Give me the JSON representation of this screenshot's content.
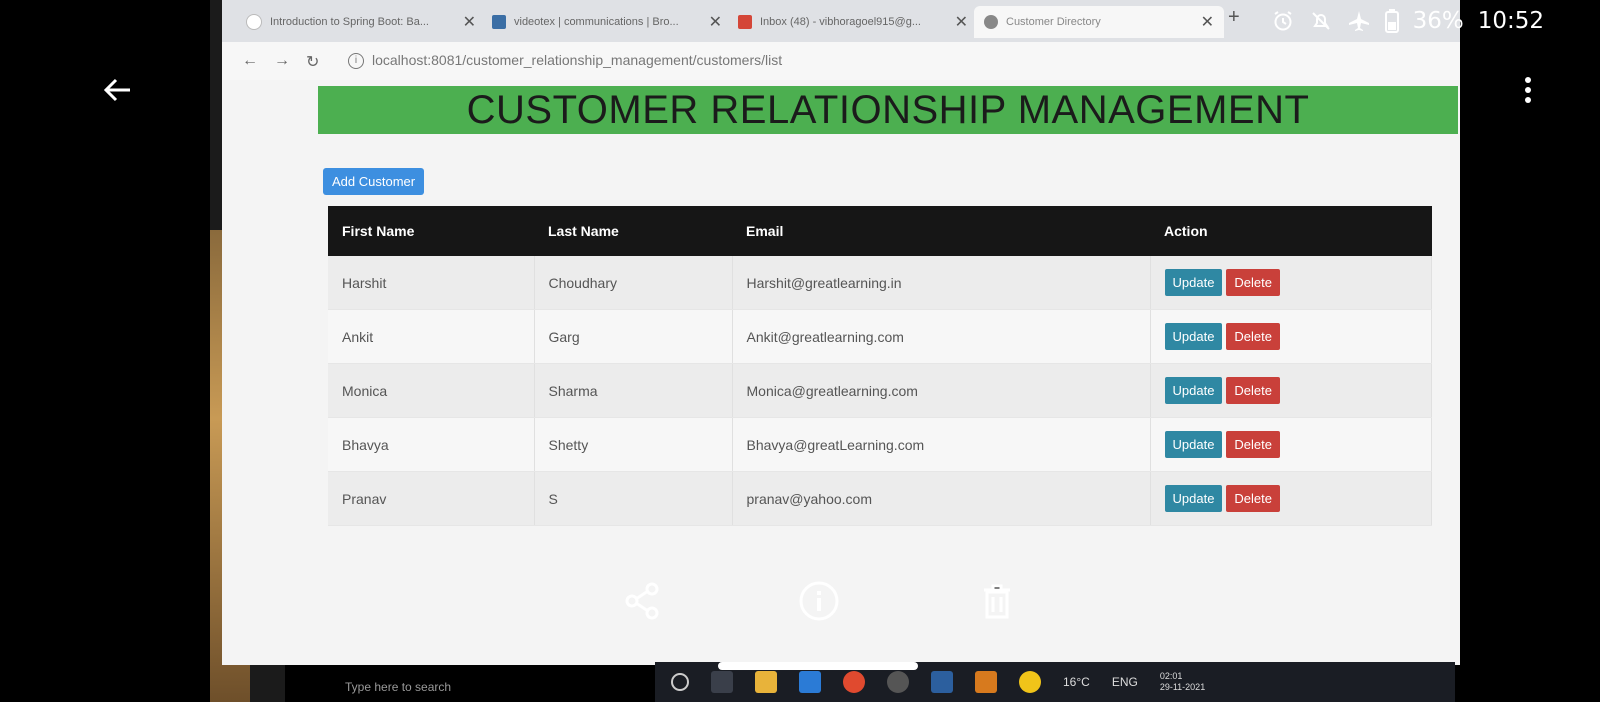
{
  "status": {
    "battery": "36%",
    "time": "10:52"
  },
  "browser": {
    "tabs": [
      {
        "title": "Introduction to Spring Boot: Ba..."
      },
      {
        "title": "videotex | communications | Bro..."
      },
      {
        "title": "Inbox (48) - vibhoragoel915@g..."
      },
      {
        "title": "Customer Directory"
      }
    ],
    "url": "localhost:8081/customer_relationship_management/customers/list"
  },
  "page": {
    "banner_title": "CUSTOMER RELATIONSHIP MANAGEMENT",
    "add_button": "Add Customer",
    "table": {
      "headers": [
        "First Name",
        "Last Name",
        "Email",
        "Action"
      ],
      "rows": [
        {
          "first": "Harshit",
          "last": "Choudhary",
          "email": "Harshit@greatlearning.in"
        },
        {
          "first": "Ankit",
          "last": "Garg",
          "email": "Ankit@greatlearning.com"
        },
        {
          "first": "Monica",
          "last": "Sharma",
          "email": "Monica@greatlearning.com"
        },
        {
          "first": "Bhavya",
          "last": "Shetty",
          "email": "Bhavya@greatLearning.com"
        },
        {
          "first": "Pranav",
          "last": "S",
          "email": "pranav@yahoo.com"
        }
      ],
      "update_label": "Update",
      "delete_label": "Delete"
    }
  },
  "taskbar": {
    "weather": "16°C",
    "lang": "ENG",
    "clock": "02:01",
    "date": "29-11-2021",
    "search_hint": "Type here to search"
  },
  "icons": {
    "back": "back-arrow-icon",
    "menu": "kebab-menu-icon",
    "share": "share-icon",
    "info": "info-icon",
    "delete": "trash-icon"
  }
}
